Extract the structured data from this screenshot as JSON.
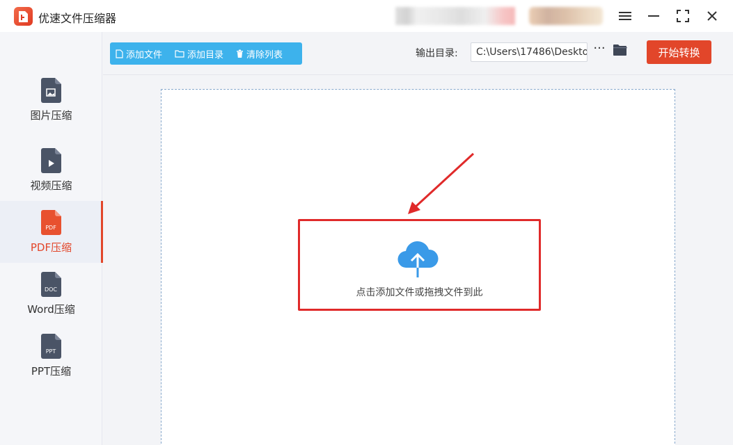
{
  "app": {
    "title": "优速文件压缩器"
  },
  "colors": {
    "accent": "#e2462a",
    "toolbar_blue": "#3db2ec",
    "cloud_blue": "#3a9ae8",
    "highlight_red": "#e02a2a"
  },
  "window_controls": {
    "menu_icon": "hamburger-icon",
    "minimize_icon": "minimize-icon",
    "fullscreen_icon": "fullscreen-icon",
    "close_icon": "close-icon"
  },
  "sidebar": {
    "items": [
      {
        "label": "图片压缩",
        "icon": "image-file-icon",
        "active": false
      },
      {
        "label": "视频压缩",
        "icon": "video-file-icon",
        "active": false
      },
      {
        "label": "PDF压缩",
        "icon": "pdf-file-icon",
        "icon_text": "PDF",
        "active": true
      },
      {
        "label": "Word压缩",
        "icon": "doc-file-icon",
        "icon_text": "DOC",
        "active": false
      },
      {
        "label": "PPT压缩",
        "icon": "ppt-file-icon",
        "icon_text": "PPT",
        "active": false
      }
    ]
  },
  "toolbar": {
    "add_file": "添加文件",
    "add_folder": "添加目录",
    "clear_list": "清除列表",
    "output_label": "输出目录:",
    "output_path": "C:\\Users\\17486\\Deskto",
    "more": "···",
    "start": "开始转换"
  },
  "dropzone": {
    "hint": "点击添加文件或拖拽文件到此"
  }
}
